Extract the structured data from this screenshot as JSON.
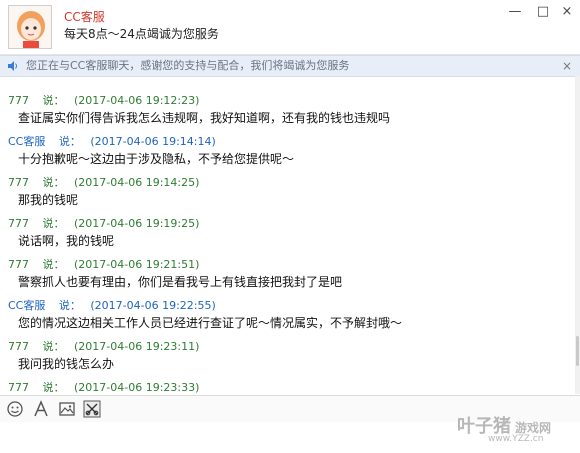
{
  "header": {
    "title": "CC客服",
    "subtitle": "每天8点～24点竭诚为您服务"
  },
  "notice": {
    "text": "您正在与CC客服聊天，感谢您的支持与配合，我们将竭诚为您服务",
    "close": "×"
  },
  "window": {
    "minimize": "—",
    "maximize": "□",
    "close": "×"
  },
  "messages": [
    {
      "sender": "777",
      "sep": "说：",
      "time": "(2017-04-06 19:12:23)",
      "text": "查证属实你们得告诉我怎么违规啊，我好知道啊，还有我的钱也违规吗"
    },
    {
      "sender": "CC客服",
      "sep": "说：",
      "time": "(2017-04-06 19:14:14)",
      "text": "十分抱歉呢～这边由于涉及隐私，不予给您提供呢～"
    },
    {
      "sender": "777",
      "sep": "说：",
      "time": "(2017-04-06 19:14:25)",
      "text": "那我的钱呢"
    },
    {
      "sender": "777",
      "sep": "说：",
      "time": "(2017-04-06 19:19:25)",
      "text": "说话啊，我的钱呢"
    },
    {
      "sender": "777",
      "sep": "说：",
      "time": "(2017-04-06 19:21:51)",
      "text": "警察抓人也要有理由，你们是看我号上有钱直接把我封了是吧"
    },
    {
      "sender": "CC客服",
      "sep": "说：",
      "time": "(2017-04-06 19:22:55)",
      "text": "您的情况这边相关工作人员已经进行查证了呢～情况属实，不予解封哦～"
    },
    {
      "sender": "777",
      "sep": "说：",
      "time": "(2017-04-06 19:23:11)",
      "text": "我问我的钱怎么办"
    },
    {
      "sender": "777",
      "sep": "说：",
      "time": "(2017-04-06 19:23:33)",
      "text": ""
    }
  ],
  "toolbar": {
    "icons": [
      "smiley-icon",
      "font-icon",
      "image-icon",
      "screenshot-icon"
    ]
  },
  "watermark": {
    "brand": "叶子猪",
    "sub": "游戏网",
    "url": "www.YZZ.cn"
  },
  "colors": {
    "agent_name": "#1f63c0",
    "user_name": "#2e7d32",
    "title_red": "#d33a2c",
    "notice_bg": "#e8eef7"
  }
}
